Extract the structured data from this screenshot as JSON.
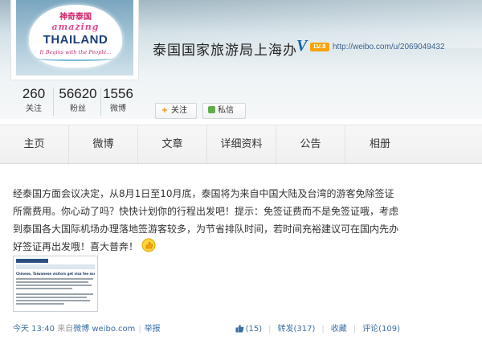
{
  "profile": {
    "name": "泰国国家旅游局上海办",
    "verified_mark": "V",
    "level_badge": "LV.8",
    "url": "http://weibo.com/u/2069049432",
    "logo": {
      "cn": "神奇泰国",
      "amazing": "amazing",
      "brand": "THAILAND",
      "tagline": "It Begins with the People..."
    }
  },
  "stats": [
    {
      "value": "260",
      "label": "关注"
    },
    {
      "value": "56620",
      "label": "粉丝"
    },
    {
      "value": "1556",
      "label": "微博"
    }
  ],
  "actions": {
    "follow_icon": "+",
    "follow_label": "关注",
    "message_label": "私信"
  },
  "nav": [
    "主页",
    "微博",
    "文章",
    "详细资料",
    "公告",
    "相册"
  ],
  "post": {
    "lines": [
      "经泰国方面会议决定，从8月1日至10月底，泰国将为来自中国大陆及台湾的游客免除签证",
      "所需费用。你心动了吗？快快计划你的行程出发吧！提示：免签证费而不是免签证哦，考虑",
      "到泰国各大国际机场办理落地签游客较多，为节省排队时间，若时间充裕建议可在国内先办",
      "好签证再出发哦！喜大普奔！"
    ],
    "emoji": "thumbs-up-icon",
    "thumbnail_title": "Chinese, Taiwanese visitors get visa fee exemption",
    "time": "今天 13:40",
    "source_prefix": "来自",
    "source": "微博 weibo.com",
    "report": "举报",
    "likes": "(15)",
    "repost": "转发(317)",
    "favorite": "收藏",
    "comment": "评论(109)"
  },
  "colors": {
    "link": "#3a6ea5",
    "verified": "#1366a6",
    "badge": "#f7a400"
  }
}
